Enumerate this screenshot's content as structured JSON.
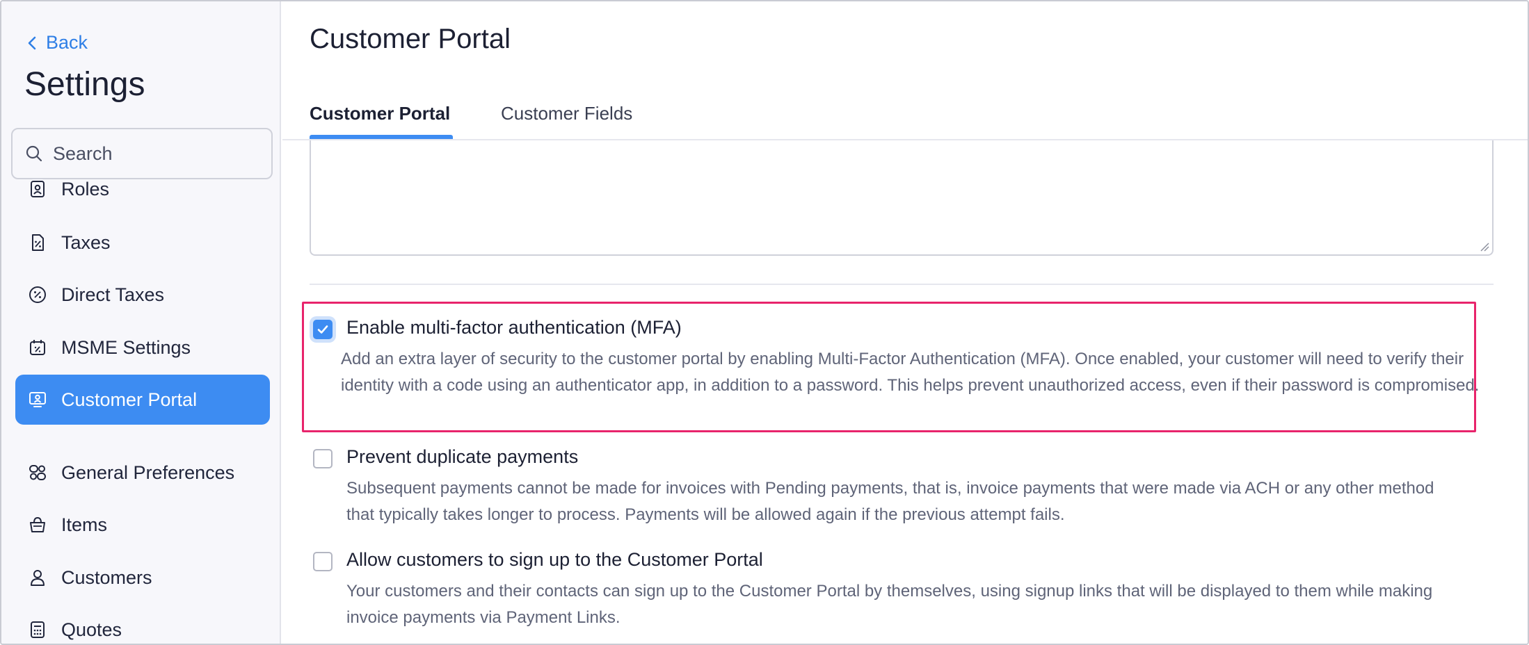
{
  "sidebar": {
    "back_label": "Back",
    "title": "Settings",
    "search_placeholder": "Search",
    "items": [
      {
        "label": "Roles",
        "icon": "id-badge-icon"
      },
      {
        "label": "Taxes",
        "icon": "tax-document-icon"
      },
      {
        "label": "Direct Taxes",
        "icon": "percent-circle-icon"
      },
      {
        "label": "MSME Settings",
        "icon": "calendar-percent-icon"
      },
      {
        "label": "Customer Portal",
        "icon": "portal-user-icon",
        "active": true
      },
      {
        "label": "General Preferences",
        "icon": "preferences-icon"
      },
      {
        "label": "Items",
        "icon": "basket-icon"
      },
      {
        "label": "Customers",
        "icon": "user-icon"
      },
      {
        "label": "Quotes",
        "icon": "calculator-icon"
      }
    ]
  },
  "main": {
    "title": "Customer Portal",
    "tabs": [
      {
        "label": "Customer Portal",
        "active": true
      },
      {
        "label": "Customer Fields",
        "active": false
      }
    ],
    "options": [
      {
        "label": "Enable multi-factor authentication (MFA)",
        "checked": true,
        "desc": "Add an extra layer of security to the customer portal by enabling Multi-Factor Authentication (MFA). Once enabled, your customer will need to verify their identity with a code using an authenticator app, in addition to a password. This helps prevent unauthorized access, even if their password is compromised."
      },
      {
        "label": "Prevent duplicate payments",
        "checked": false,
        "desc": "Subsequent payments cannot be made for invoices with Pending payments, that is, invoice payments that were made via ACH or any other method that typically takes longer to process. Payments will be allowed again if the previous attempt fails."
      },
      {
        "label": "Allow customers to sign up to the Customer Portal",
        "checked": false,
        "desc": "Your customers and their contacts can sign up to the Customer Portal by themselves, using signup links that will be displayed to them while making invoice payments via Payment Links."
      }
    ]
  },
  "colors": {
    "accent": "#3d8cf2",
    "highlight": "#e8246b",
    "link": "#2f7fe6"
  }
}
